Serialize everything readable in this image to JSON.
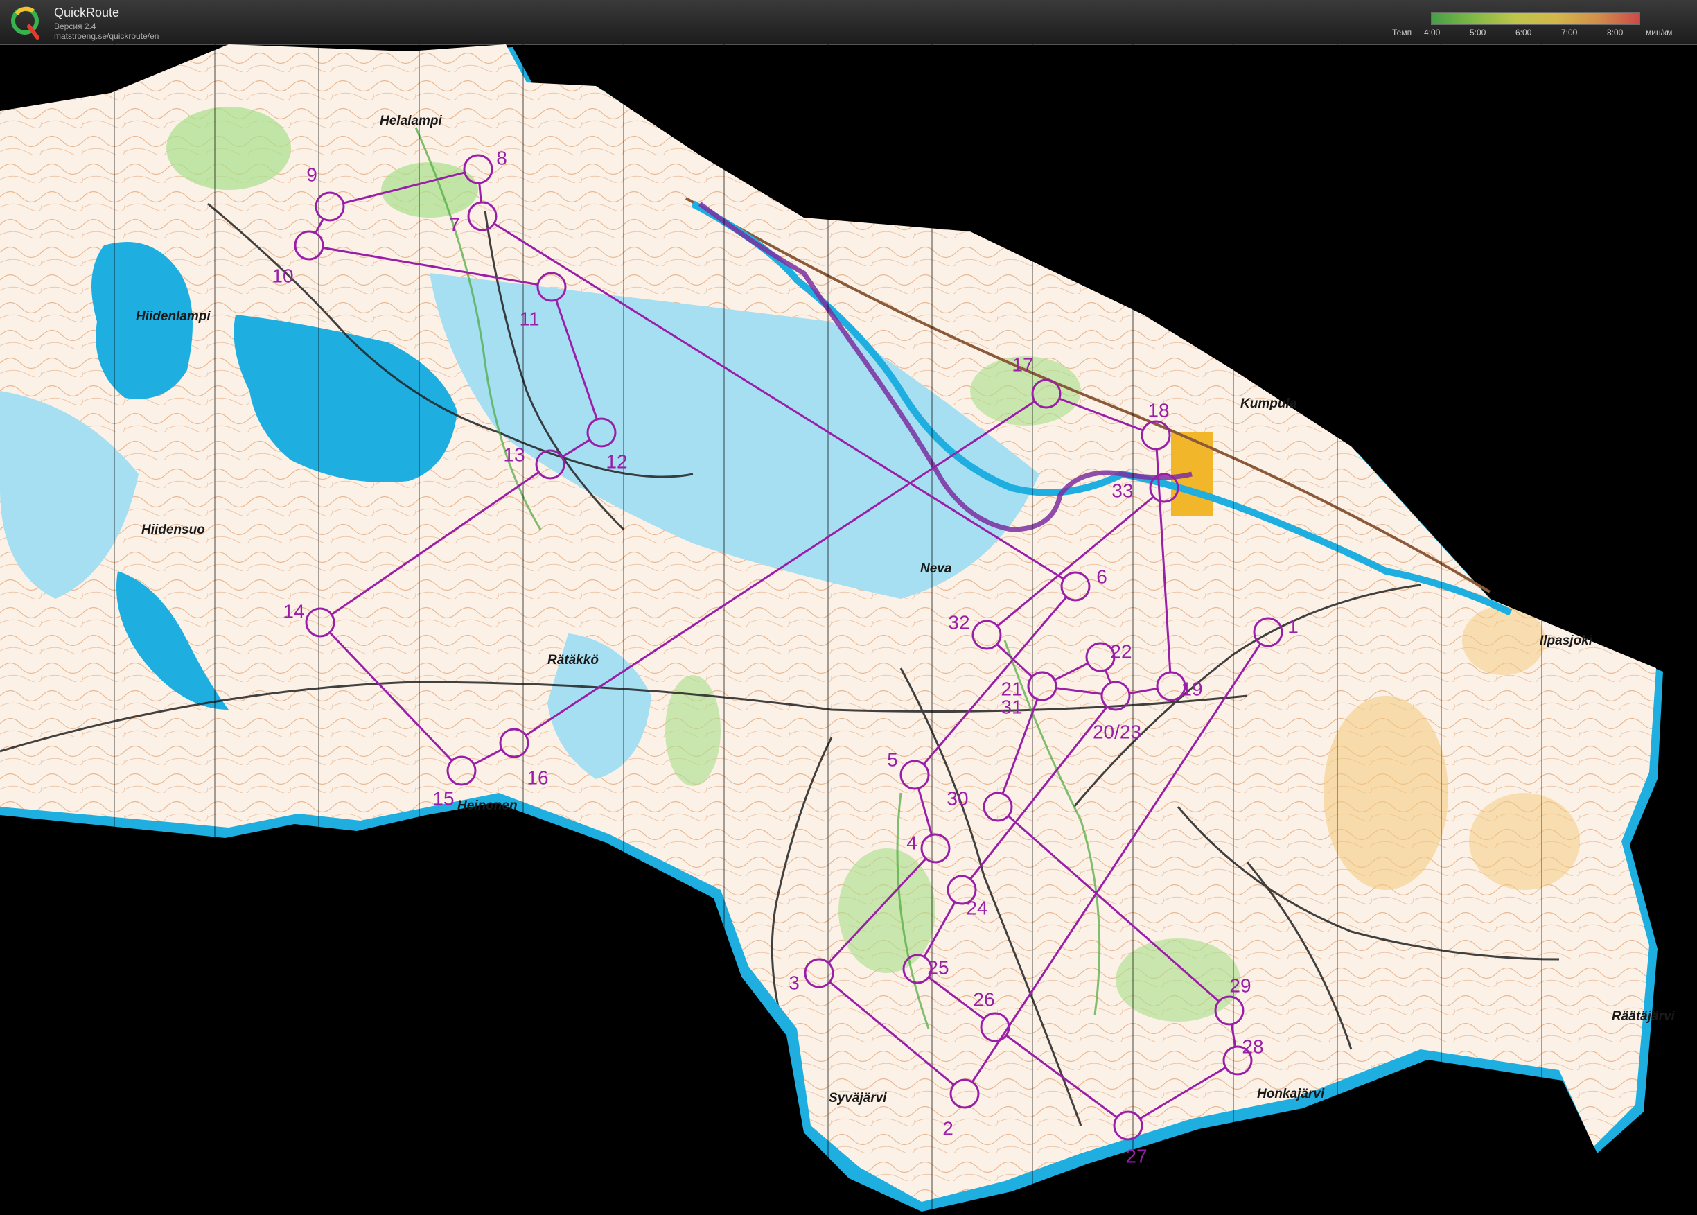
{
  "app": {
    "title": "QuickRoute",
    "version": "Версия 2.4",
    "url": "matstroeng.se/quickroute/en",
    "logo_letter": "Q"
  },
  "legend": {
    "label": "Темп",
    "unit": "мин/км",
    "ticks": [
      "4:00",
      "5:00",
      "6:00",
      "7:00",
      "8:00"
    ]
  },
  "colors": {
    "water": "#1eaee0",
    "land": "#fbf1e6",
    "contour": "#c8672e",
    "course": "#9a1fa8",
    "route": "#7b2fa0",
    "open": "#f4c97a",
    "green": "#9edc7a",
    "urban": "#f2b62a"
  },
  "place_names": {
    "helalampi": "Helalampi",
    "hiidenlampi": "Hiidenlampi",
    "hiidensuo": "Hiidensuo",
    "ratakko": "Rätäkkö",
    "heinonen": "Heinonen",
    "neva": "Neva",
    "kumpula": "Kumpula",
    "ilpasjoki": "Ilpasjoki",
    "syvajarvi": "Syväjärvi",
    "honkajarvi": "Honkajärvi",
    "raatajarvi": "Räätäjärvi"
  },
  "controls": [
    "1",
    "2",
    "3",
    "4",
    "5",
    "6",
    "7",
    "8",
    "9",
    "10",
    "11",
    "12",
    "13",
    "14",
    "15",
    "16",
    "17",
    "18",
    "19",
    "20/23",
    "21",
    "22",
    "24",
    "25",
    "26",
    "27",
    "28",
    "29",
    "30",
    "31",
    "32",
    "33"
  ]
}
